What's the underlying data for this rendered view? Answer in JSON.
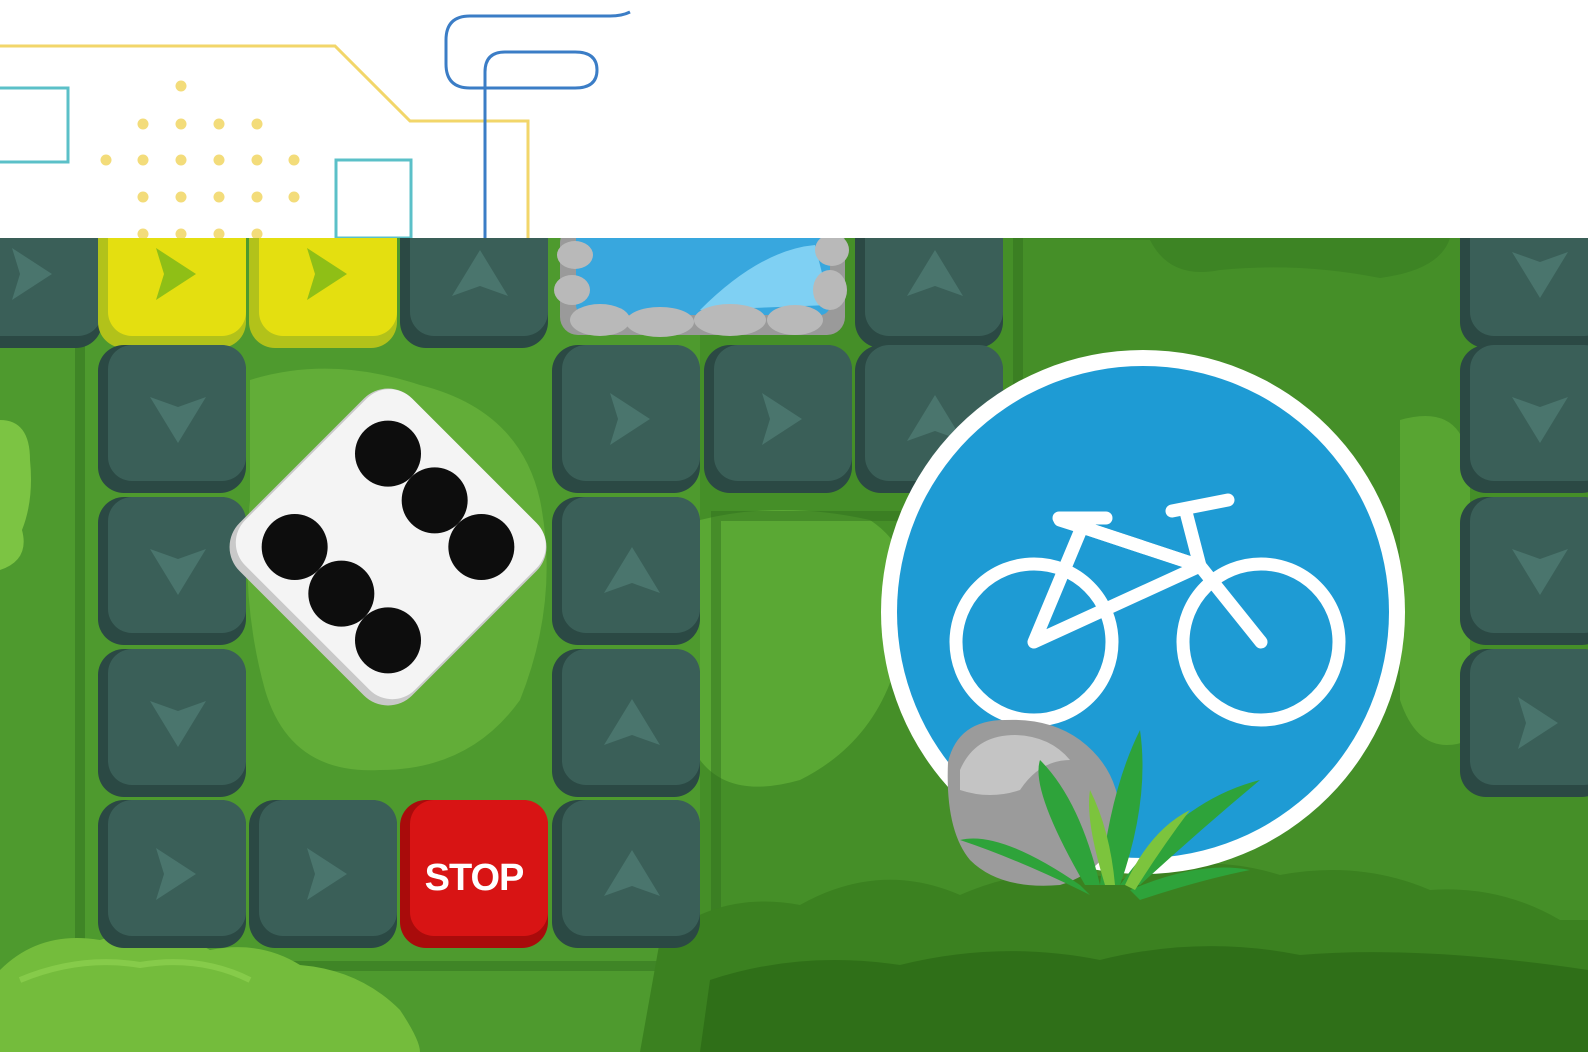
{
  "board": {
    "stop_label": "STOP",
    "dice_face": 6,
    "colors": {
      "background_grass": "#4e9a2e",
      "dark_grass": "#3a7f22",
      "light_grass": "#63b23a",
      "tile": "#3a5f58",
      "tile_highlight": "#e4df10",
      "stop_tile": "#d81414",
      "sign_blue": "#1e9bd4"
    },
    "tiles": [
      {
        "id": "r0c0",
        "kind": "arrow",
        "dir": "right"
      },
      {
        "id": "r0c1",
        "kind": "highlight",
        "dir": "right"
      },
      {
        "id": "r0c2",
        "kind": "highlight",
        "dir": "right"
      },
      {
        "id": "r0c3",
        "kind": "arrow",
        "dir": "up"
      },
      {
        "id": "r0c6",
        "kind": "arrow",
        "dir": "up"
      },
      {
        "id": "r0c9",
        "kind": "arrow",
        "dir": "down"
      },
      {
        "id": "r1c1",
        "kind": "arrow",
        "dir": "down"
      },
      {
        "id": "r1c4",
        "kind": "arrow",
        "dir": "right"
      },
      {
        "id": "r1c5",
        "kind": "arrow",
        "dir": "right"
      },
      {
        "id": "r1c6",
        "kind": "arrow",
        "dir": "up"
      },
      {
        "id": "r1c9",
        "kind": "arrow",
        "dir": "down"
      },
      {
        "id": "r2c1",
        "kind": "arrow",
        "dir": "down"
      },
      {
        "id": "r2c4",
        "kind": "arrow",
        "dir": "up"
      },
      {
        "id": "r2c9",
        "kind": "arrow",
        "dir": "down"
      },
      {
        "id": "r3c1",
        "kind": "arrow",
        "dir": "down"
      },
      {
        "id": "r3c4",
        "kind": "arrow",
        "dir": "up"
      },
      {
        "id": "r3c9",
        "kind": "arrow",
        "dir": "right"
      },
      {
        "id": "r4c1",
        "kind": "arrow",
        "dir": "right"
      },
      {
        "id": "r4c2",
        "kind": "arrow",
        "dir": "right"
      },
      {
        "id": "r4c3",
        "kind": "stop",
        "dir": "none"
      },
      {
        "id": "r4c4",
        "kind": "arrow",
        "dir": "up"
      }
    ]
  }
}
